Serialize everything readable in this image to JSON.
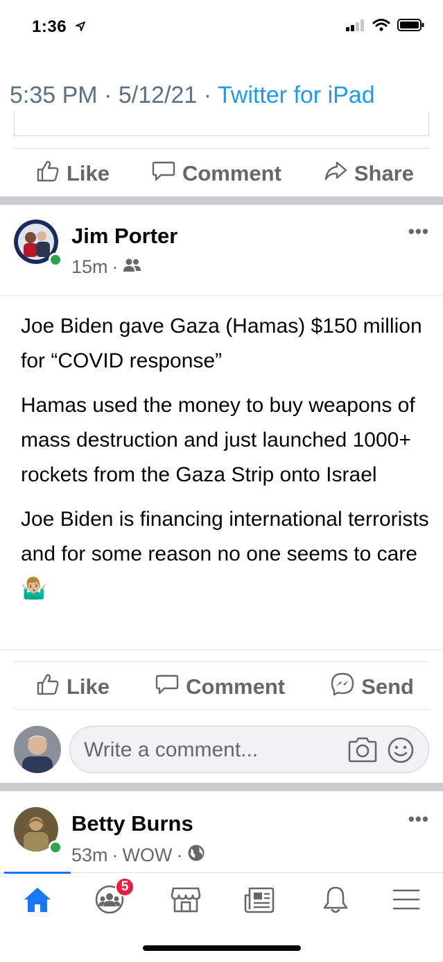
{
  "status_bar": {
    "time": "1:36"
  },
  "previous_post": {
    "tweet_time": "5:35 PM · 5/12/21 · ",
    "tweet_source": "Twitter for iPad",
    "actions": {
      "like": "Like",
      "comment": "Comment",
      "share": "Share"
    }
  },
  "post": {
    "author": "Jim Porter",
    "time": "15m",
    "meta_sep": "·",
    "paragraphs": [
      "Joe Biden gave Gaza (Hamas) $150 million for “COVID response”",
      "Hamas used the money to buy weapons of mass destruction and just launched 1000+ rockets from the Gaza Strip onto Israel",
      "Joe Biden is financing international terrorists and for some reason no one seems to care 🤷🏼‍♂️"
    ],
    "actions": {
      "like": "Like",
      "comment": "Comment",
      "send": "Send"
    },
    "comment_placeholder": "Write a comment..."
  },
  "next_post": {
    "author": "Betty Burns",
    "time": "53m",
    "feeling": "WOW",
    "meta_sep": "·"
  },
  "bottom_nav": {
    "groups_badge": "5"
  },
  "colors": {
    "accent": "#1877f2",
    "twitter_blue": "#1d9bf0",
    "online": "#31a24c",
    "badge": "#e41e3f"
  }
}
